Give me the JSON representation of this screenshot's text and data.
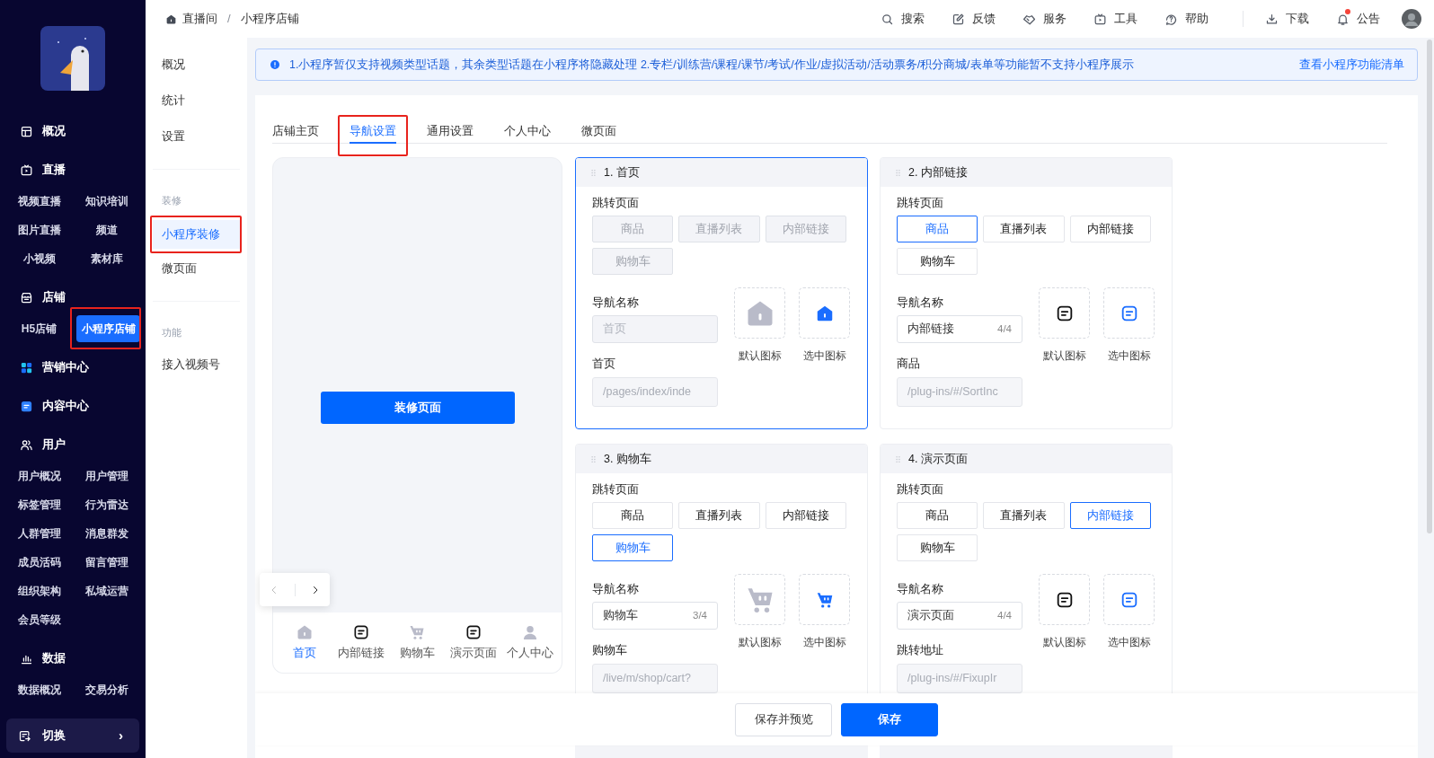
{
  "sidebar": {
    "sections": [
      {
        "label": "概况",
        "kind": "overview"
      },
      {
        "label": "直播",
        "kind": "live",
        "items": [
          {
            "label": "视频直播",
            "selected": false,
            "highlighted": false
          },
          {
            "label": "知识培训",
            "selected": false,
            "highlighted": false
          },
          {
            "label": "图片直播",
            "selected": false,
            "highlighted": false
          },
          {
            "label": "频道",
            "selected": false,
            "highlighted": false
          },
          {
            "label": "小视频",
            "selected": false,
            "highlighted": false
          },
          {
            "label": "素材库",
            "selected": false,
            "highlighted": false
          }
        ]
      },
      {
        "label": "店铺",
        "kind": "store",
        "items": [
          {
            "label": "H5店铺",
            "selected": false,
            "highlighted": false
          },
          {
            "label": "小程序店铺",
            "selected": true,
            "highlighted": true
          }
        ]
      },
      {
        "label": "营销中心",
        "kind": "marketing"
      },
      {
        "label": "内容中心",
        "kind": "content"
      },
      {
        "label": "用户",
        "kind": "user",
        "items": [
          {
            "label": "用户概况",
            "selected": false,
            "highlighted": false
          },
          {
            "label": "用户管理",
            "selected": false,
            "highlighted": false
          },
          {
            "label": "标签管理",
            "selected": false,
            "highlighted": false
          },
          {
            "label": "行为雷达",
            "selected": false,
            "highlighted": false
          },
          {
            "label": "人群管理",
            "selected": false,
            "highlighted": false
          },
          {
            "label": "消息群发",
            "selected": false,
            "highlighted": false
          },
          {
            "label": "成员活码",
            "selected": false,
            "highlighted": false
          },
          {
            "label": "留言管理",
            "selected": false,
            "highlighted": false
          },
          {
            "label": "组织架构",
            "selected": false,
            "highlighted": false
          },
          {
            "label": "私域运营",
            "selected": false,
            "highlighted": false
          },
          {
            "label": "会员等级",
            "selected": false,
            "highlighted": false
          }
        ]
      },
      {
        "label": "数据",
        "kind": "data",
        "items": [
          {
            "label": "数据概况",
            "selected": false,
            "highlighted": false
          },
          {
            "label": "交易分析",
            "selected": false,
            "highlighted": false
          }
        ]
      }
    ],
    "switch_button": {
      "label": "切换",
      "arrow": "›"
    }
  },
  "breadcrumb": {
    "items": [
      "直播间",
      "小程序店铺"
    ],
    "separator": "/"
  },
  "toolbar": [
    {
      "label": "搜索",
      "kind": "search",
      "badge": false
    },
    {
      "label": "反馈",
      "kind": "edit",
      "badge": false
    },
    {
      "label": "服务",
      "kind": "service",
      "badge": false
    },
    {
      "label": "工具",
      "kind": "tool",
      "badge": false
    },
    {
      "label": "帮助",
      "kind": "help",
      "badge": false
    },
    {
      "label": "下载",
      "kind": "download",
      "badge": false
    },
    {
      "label": "公告",
      "kind": "bell",
      "badge": true
    }
  ],
  "subnav": {
    "groups": [
      {
        "items": [
          {
            "label": "概况",
            "selected": false,
            "highlighted": false
          },
          {
            "label": "统计",
            "selected": false,
            "highlighted": false
          },
          {
            "label": "设置",
            "selected": false,
            "highlighted": false
          }
        ]
      },
      {
        "heading": "装修",
        "items": [
          {
            "label": "小程序装修",
            "selected": true,
            "highlighted": true
          },
          {
            "label": "微页面",
            "selected": false,
            "highlighted": false
          }
        ]
      },
      {
        "heading": "功能",
        "items": [
          {
            "label": "接入视频号",
            "selected": false,
            "highlighted": false
          }
        ]
      }
    ]
  },
  "notice": {
    "text": "1.小程序暂仅支持视频类型话题，其余类型话题在小程序将隐藏处理 2.专栏/训练营/课程/课节/考试/作业/虚拟活动/活动票务/积分商城/表单等功能暂不支持小程序展示",
    "link": "查看小程序功能清单"
  },
  "tabs": [
    {
      "label": "店铺主页",
      "selected": false,
      "highlighted": false
    },
    {
      "label": "导航设置",
      "selected": true,
      "highlighted": true
    },
    {
      "label": "通用设置",
      "selected": false,
      "highlighted": false
    },
    {
      "label": "个人中心",
      "selected": false,
      "highlighted": false
    },
    {
      "label": "微页面",
      "selected": false,
      "highlighted": false
    }
  ],
  "preview": {
    "button": "装修页面",
    "tab_bar": [
      {
        "label": "首页",
        "kind": "home",
        "selected": true
      },
      {
        "label": "内部链接",
        "kind": "page",
        "selected": false
      },
      {
        "label": "购物车",
        "kind": "cart",
        "selected": false
      },
      {
        "label": "演示页面",
        "kind": "page",
        "selected": false
      },
      {
        "label": "个人中心",
        "kind": "person",
        "selected": false
      }
    ]
  },
  "nav_items": [
    {
      "title": "1. 首页",
      "active": true,
      "disabled": true,
      "jump_label": "跳转页面",
      "targets": [
        {
          "label": "商品",
          "selected": false
        },
        {
          "label": "直播列表",
          "selected": false
        },
        {
          "label": "内部链接",
          "selected": false
        },
        {
          "label": "购物车",
          "selected": false
        }
      ],
      "name_label": "导航名称",
      "name": {
        "placeholder": "首页"
      },
      "address_label": "首页",
      "address": "/pages/index/inde",
      "kind": "home",
      "default_icon_label": "默认图标",
      "selected_icon_label": "选中图标"
    },
    {
      "title": "2. 内部链接",
      "active": false,
      "disabled": false,
      "jump_label": "跳转页面",
      "targets": [
        {
          "label": "商品",
          "selected": true
        },
        {
          "label": "直播列表",
          "selected": false
        },
        {
          "label": "内部链接",
          "selected": false
        },
        {
          "label": "购物车",
          "selected": false
        }
      ],
      "name_label": "导航名称",
      "name": {
        "value": "内部链接",
        "counter": "4/4"
      },
      "address_label": "商品",
      "address": "/plug-ins/#/SortInc",
      "kind": "page",
      "default_icon_label": "默认图标",
      "selected_icon_label": "选中图标"
    },
    {
      "title": "3. 购物车",
      "active": false,
      "disabled": false,
      "jump_label": "跳转页面",
      "targets": [
        {
          "label": "商品",
          "selected": false
        },
        {
          "label": "直播列表",
          "selected": false
        },
        {
          "label": "内部链接",
          "selected": false
        },
        {
          "label": "购物车",
          "selected": true
        }
      ],
      "name_label": "导航名称",
      "name": {
        "value": "购物车",
        "counter": "3/4"
      },
      "address_label": "购物车",
      "address": "/live/m/shop/cart?",
      "kind": "cart",
      "default_icon_label": "默认图标",
      "selected_icon_label": "选中图标"
    },
    {
      "title": "4. 演示页面",
      "active": false,
      "disabled": false,
      "jump_label": "跳转页面",
      "targets": [
        {
          "label": "商品",
          "selected": false
        },
        {
          "label": "直播列表",
          "selected": false
        },
        {
          "label": "内部链接",
          "selected": true
        },
        {
          "label": "购物车",
          "selected": false
        }
      ],
      "name_label": "导航名称",
      "name": {
        "value": "演示页面",
        "counter": "4/4"
      },
      "address_label": "跳转地址",
      "address": "/plug-ins/#/FixupIr",
      "kind": "page",
      "default_icon_label": "默认图标",
      "selected_icon_label": "选中图标"
    }
  ],
  "footer": {
    "buttons": [
      {
        "label": "保存并预览",
        "kind": "secondary"
      },
      {
        "label": "保存",
        "kind": "primary"
      }
    ]
  }
}
